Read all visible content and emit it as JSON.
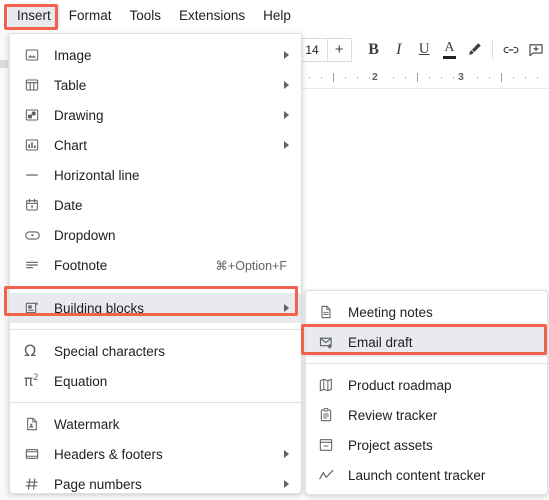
{
  "menubar": {
    "items": [
      {
        "label": "Insert",
        "active": true
      },
      {
        "label": "Format",
        "active": false
      },
      {
        "label": "Tools",
        "active": false
      },
      {
        "label": "Extensions",
        "active": false
      },
      {
        "label": "Help",
        "active": false
      }
    ]
  },
  "toolbar": {
    "font_size_value": "14",
    "increase_font_label": "+",
    "bold_label": "B",
    "italic_label": "I",
    "underline_label": "U",
    "text_color_label": "A",
    "highlight_icon": "highlighter-icon",
    "link_icon": "link-icon",
    "comment_icon": "add-comment-icon"
  },
  "ruler": {
    "numbers": [
      "2",
      "3"
    ]
  },
  "insert_menu": {
    "groups": [
      {
        "items": [
          {
            "label": "Image",
            "icon": "image-icon",
            "submenu": true,
            "accel": ""
          },
          {
            "label": "Table",
            "icon": "table-icon",
            "submenu": true,
            "accel": ""
          },
          {
            "label": "Drawing",
            "icon": "drawing-icon",
            "submenu": true,
            "accel": ""
          },
          {
            "label": "Chart",
            "icon": "chart-icon",
            "submenu": true,
            "accel": ""
          },
          {
            "label": "Horizontal line",
            "icon": "horizontal-line-icon",
            "submenu": false,
            "accel": ""
          },
          {
            "label": "Date",
            "icon": "date-icon",
            "submenu": false,
            "accel": ""
          },
          {
            "label": "Dropdown",
            "icon": "dropdown-icon",
            "submenu": false,
            "accel": ""
          },
          {
            "label": "Footnote",
            "icon": "footnote-icon",
            "submenu": false,
            "accel": "⌘+Option+F"
          }
        ]
      },
      {
        "items": [
          {
            "label": "Building blocks",
            "icon": "building-blocks-icon",
            "submenu": true,
            "accel": "",
            "highlighted": true
          }
        ]
      },
      {
        "items": [
          {
            "label": "Special characters",
            "icon": "omega-icon",
            "submenu": false,
            "accel": ""
          },
          {
            "label": "Equation",
            "icon": "equation-icon",
            "submenu": false,
            "accel": ""
          }
        ]
      },
      {
        "items": [
          {
            "label": "Watermark",
            "icon": "watermark-icon",
            "submenu": false,
            "accel": ""
          },
          {
            "label": "Headers & footers",
            "icon": "headers-footers-icon",
            "submenu": true,
            "accel": ""
          },
          {
            "label": "Page numbers",
            "icon": "page-numbers-icon",
            "submenu": true,
            "accel": ""
          }
        ]
      }
    ]
  },
  "building_blocks_submenu": {
    "groups": [
      {
        "items": [
          {
            "label": "Meeting notes",
            "icon": "document-icon"
          },
          {
            "label": "Email draft",
            "icon": "email-draft-icon",
            "highlighted": true
          }
        ]
      },
      {
        "items": [
          {
            "label": "Product roadmap",
            "icon": "map-icon"
          },
          {
            "label": "Review tracker",
            "icon": "clipboard-icon"
          },
          {
            "label": "Project assets",
            "icon": "archive-icon"
          },
          {
            "label": "Launch content tracker",
            "icon": "trend-line-icon"
          }
        ]
      }
    ]
  },
  "annotations": {
    "highlight_color": "#f4624e",
    "boxes": [
      {
        "name": "insert-menubar-highlight"
      },
      {
        "name": "building-blocks-highlight"
      },
      {
        "name": "email-draft-highlight"
      }
    ]
  }
}
